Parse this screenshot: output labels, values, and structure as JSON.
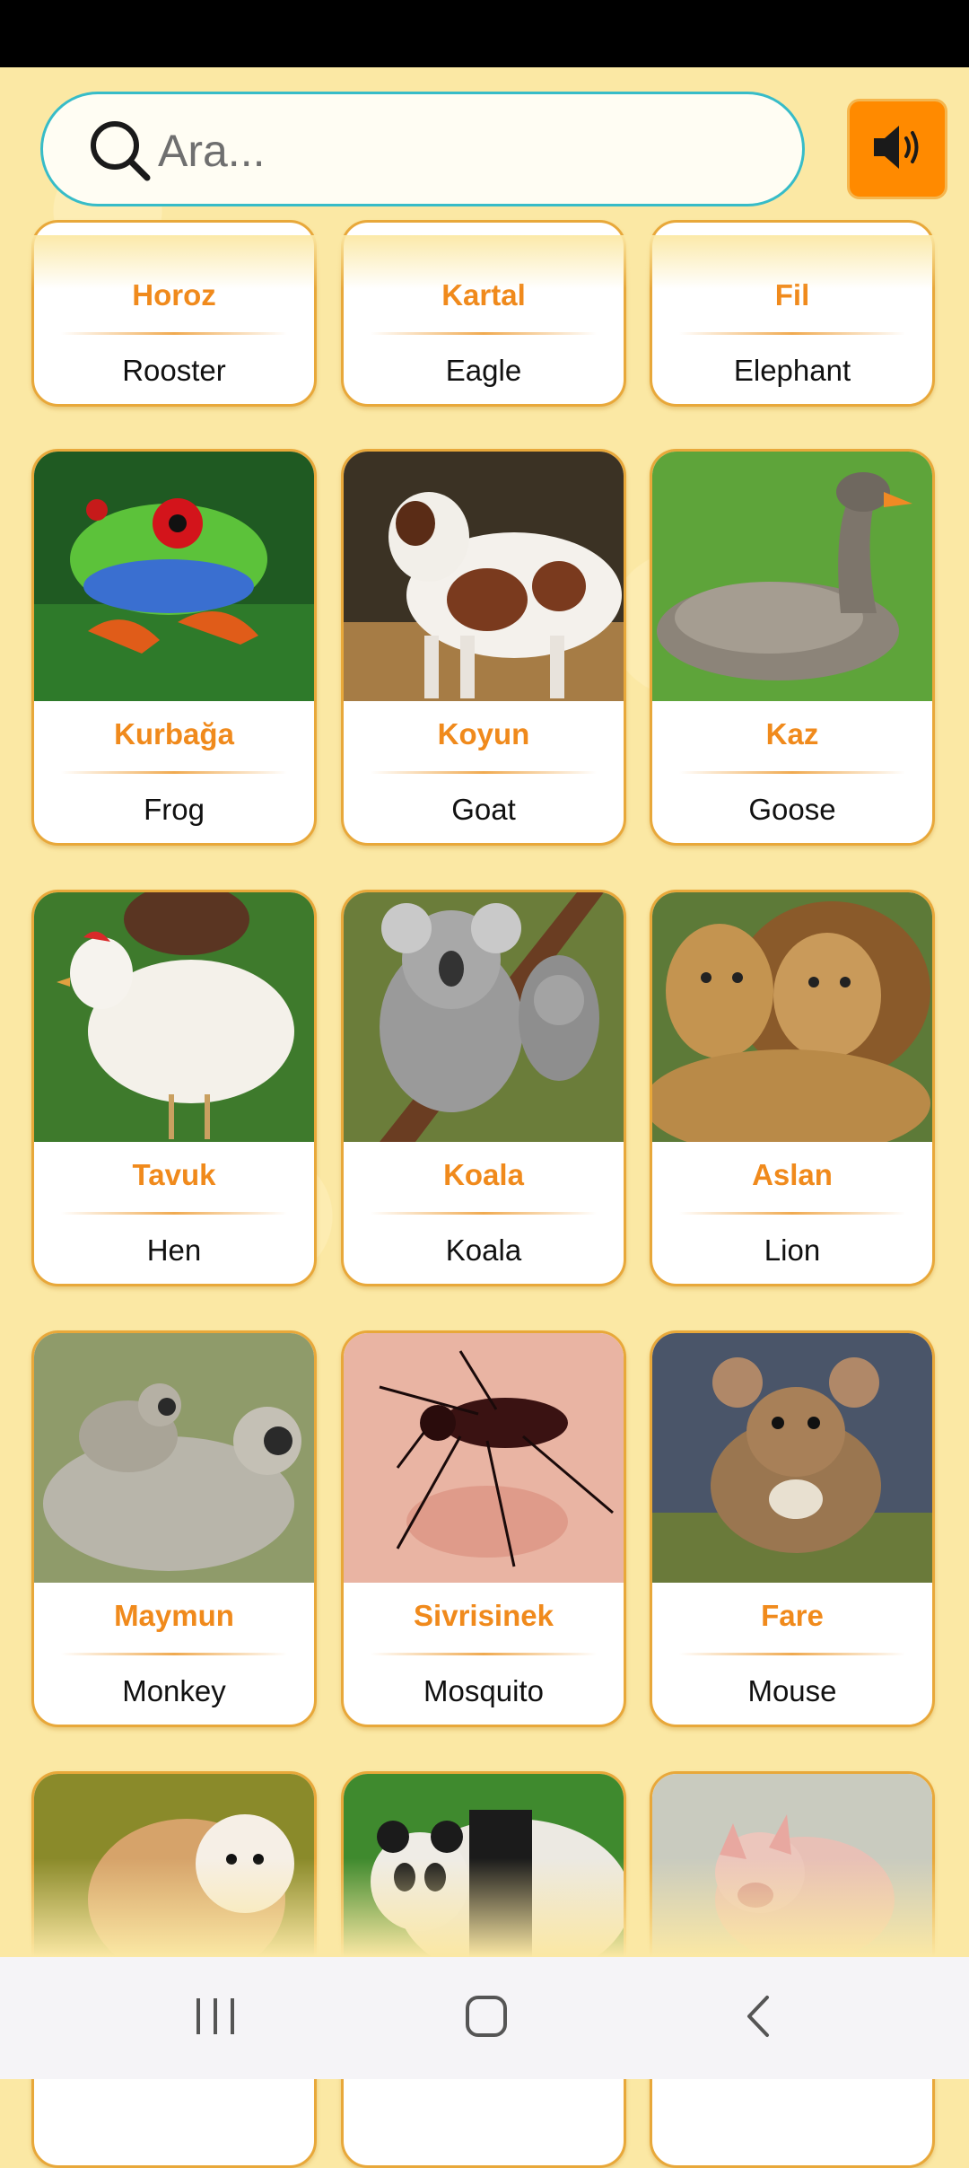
{
  "search": {
    "placeholder": "Ara..."
  },
  "sound_button": {
    "icon": "speaker-icon",
    "color": "#ff8a00"
  },
  "cards": [
    {
      "tr": "Horoz",
      "en": "Rooster",
      "image": "rooster-photo"
    },
    {
      "tr": "Kartal",
      "en": "Eagle",
      "image": "eagle-photo"
    },
    {
      "tr": "Fil",
      "en": "Elephant",
      "image": "elephant-photo"
    },
    {
      "tr": "Kurbağa",
      "en": "Frog",
      "image": "frog-photo"
    },
    {
      "tr": "Koyun",
      "en": "Goat",
      "image": "goat-photo"
    },
    {
      "tr": "Kaz",
      "en": "Goose",
      "image": "goose-photo"
    },
    {
      "tr": "Tavuk",
      "en": "Hen",
      "image": "hen-photo"
    },
    {
      "tr": "Koala",
      "en": "Koala",
      "image": "koala-photo"
    },
    {
      "tr": "Aslan",
      "en": "Lion",
      "image": "lion-photo"
    },
    {
      "tr": "Maymun",
      "en": "Monkey",
      "image": "monkey-photo"
    },
    {
      "tr": "Sivrisinek",
      "en": "Mosquito",
      "image": "mosquito-photo"
    },
    {
      "tr": "Fare",
      "en": "Mouse",
      "image": "mouse-photo"
    },
    {
      "tr": "",
      "en": "",
      "image": "owl-photo"
    },
    {
      "tr": "",
      "en": "",
      "image": "panda-photo"
    },
    {
      "tr": "",
      "en": "",
      "image": "pig-photo"
    }
  ],
  "colors": {
    "accent": "#f08a1c",
    "card_border": "#e8a83a",
    "background": "#fbe8a4",
    "search_border": "#37bcc8"
  },
  "nav": {
    "recent_icon": "recent-apps-icon",
    "home_icon": "home-icon",
    "back_icon": "back-icon"
  }
}
